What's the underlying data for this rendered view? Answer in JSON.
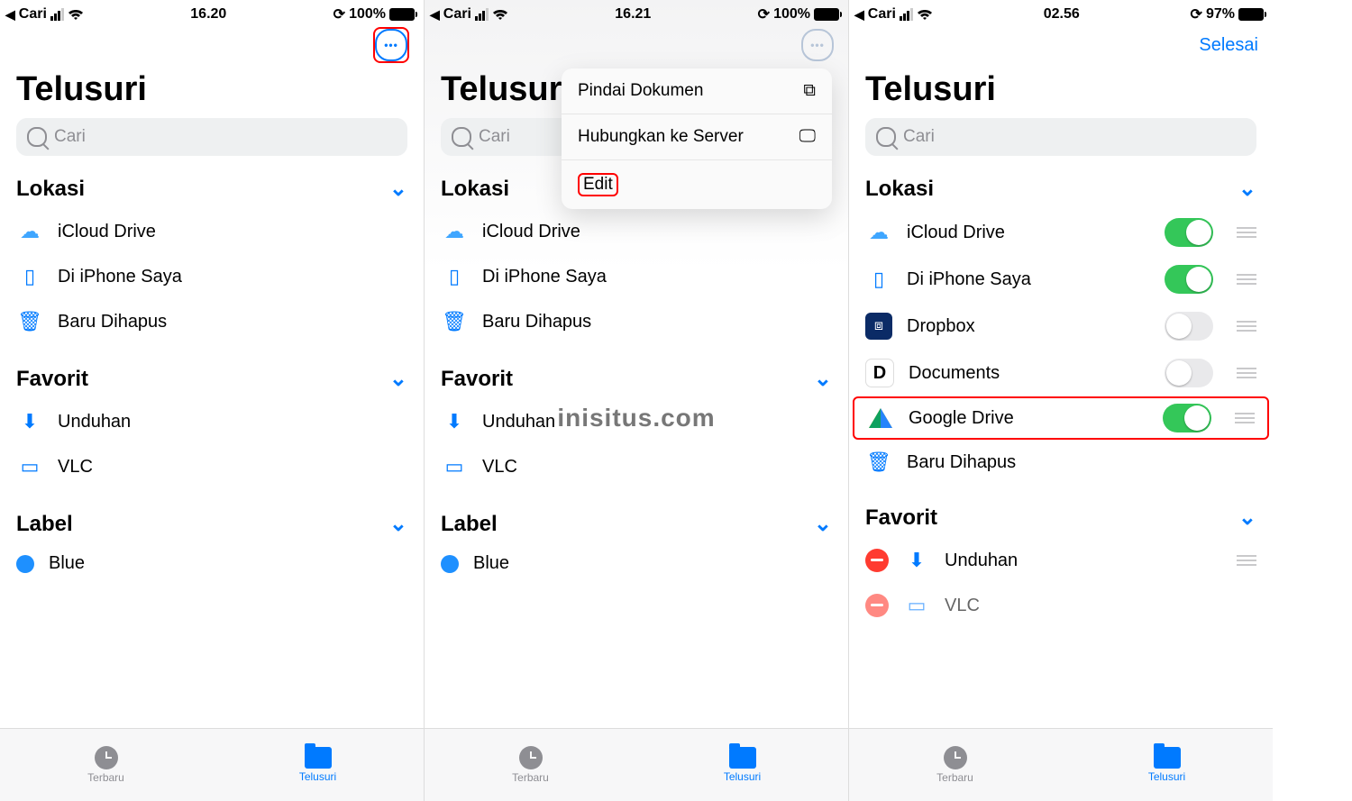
{
  "watermark": "inisitus.com",
  "tabs": {
    "recent": "Terbaru",
    "browse": "Telusuri"
  },
  "common": {
    "title": "Telusuri",
    "search_placeholder": "Cari",
    "back_app": "Cari",
    "sections": {
      "lokasi": "Lokasi",
      "favorit": "Favorit",
      "label": "Label"
    },
    "rows": {
      "icloud": "iCloud Drive",
      "iphone": "Di iPhone Saya",
      "trash": "Baru Dihapus",
      "unduh": "Unduhan",
      "vlc": "VLC",
      "blue": "Blue",
      "dropbox": "Dropbox",
      "documents": "Documents",
      "gdrive": "Google Drive"
    }
  },
  "s1": {
    "time": "16.20",
    "batt": "100%"
  },
  "s2": {
    "time": "16.21",
    "batt": "100%",
    "menu": {
      "scan": "Pindai Dokumen",
      "connect": "Hubungkan ke Server",
      "edit": "Edit"
    }
  },
  "s3": {
    "time": "02.56",
    "batt": "97%",
    "done": "Selesai"
  }
}
